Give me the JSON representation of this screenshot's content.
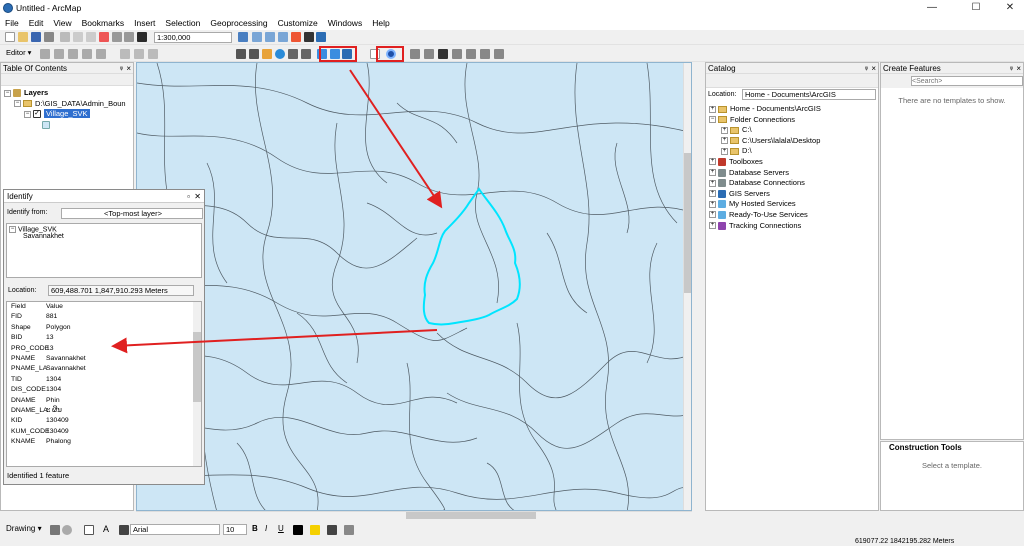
{
  "window": {
    "title": "Untitled - ArcMap",
    "min_icon": "minimize-icon",
    "max_icon": "maximize-icon",
    "close_icon": "close-icon",
    "min": "—",
    "max": "☐",
    "close": "✕"
  },
  "menu": [
    "File",
    "Edit",
    "View",
    "Bookmarks",
    "Insert",
    "Selection",
    "Geoprocessing",
    "Customize",
    "Windows",
    "Help"
  ],
  "toolbar": {
    "scale": "1:300,000",
    "editor": "Editor ▾"
  },
  "toc": {
    "title": "Table Of Contents",
    "root": "Layers",
    "group": "D:\\GIS_DATA\\Admin_Boun",
    "layer": "Village_SVK"
  },
  "identify": {
    "title": "Identify",
    "from_label": "Identify from:",
    "from_value": "<Top-most layer>",
    "tree_layer": "Village_SVK",
    "tree_feature": "Savannakhet",
    "location_label": "Location:",
    "location_value": "609,488.701  1,847,910.293 Meters",
    "header_field": "Field",
    "header_value": "Value",
    "rows": [
      [
        "FID",
        "881"
      ],
      [
        "Shape",
        "Polygon"
      ],
      [
        "BID",
        "13"
      ],
      [
        "PRO_CODE",
        "13"
      ],
      [
        "PNAME",
        "Savannakhet"
      ],
      [
        "PNAME_LA",
        "Savannakhet"
      ],
      [
        "TID",
        "1304"
      ],
      [
        "DIS_CODE",
        "1304"
      ],
      [
        "DNAME",
        "Phin"
      ],
      [
        "DNAME_LA",
        "ະ ຜີນ"
      ],
      [
        "KID",
        "130409"
      ],
      [
        "KUM_CODE",
        "130409"
      ],
      [
        "KNAME",
        "Phalong"
      ]
    ],
    "footer": "Identified 1 feature"
  },
  "catalog": {
    "title": "Catalog",
    "location_label": "Location:",
    "location_value": "Home - Documents\\ArcGIS",
    "items": [
      {
        "label": "Home - Documents\\ArcGIS",
        "level": 0,
        "icon": "folder-icon"
      },
      {
        "label": "Folder Connections",
        "level": 0,
        "icon": "folder-icon"
      },
      {
        "label": "C:\\",
        "level": 1,
        "icon": "folder-icon"
      },
      {
        "label": "C:\\Users\\lalala\\Desktop",
        "level": 1,
        "icon": "folder-icon"
      },
      {
        "label": "D:\\",
        "level": 1,
        "icon": "folder-icon"
      },
      {
        "label": "Toolboxes",
        "level": 0,
        "icon": "toolbox-icon"
      },
      {
        "label": "Database Servers",
        "level": 0,
        "icon": "database-icon"
      },
      {
        "label": "Database Connections",
        "level": 0,
        "icon": "database-icon"
      },
      {
        "label": "GIS Servers",
        "level": 0,
        "icon": "server-icon"
      },
      {
        "label": "My Hosted Services",
        "level": 0,
        "icon": "cloud-icon"
      },
      {
        "label": "Ready-To-Use Services",
        "level": 0,
        "icon": "cloud-icon"
      },
      {
        "label": "Tracking Connections",
        "level": 0,
        "icon": "tracking-icon"
      }
    ]
  },
  "create_features": {
    "title": "Create Features",
    "search_placeholder": "<Search>",
    "empty": "There are no templates to show."
  },
  "construction": {
    "title": "Construction Tools",
    "empty": "Select a template."
  },
  "drawing": {
    "label": "Drawing ▾",
    "font": "Arial",
    "size": "10",
    "bold": "B",
    "italic": "I",
    "underline": "U"
  },
  "status": {
    "coords": "619077.22  1842195.282 Meters"
  },
  "colors": {
    "map_bg": "#cde6f5",
    "highlight": "#00e5ff",
    "arrow": "#e02020",
    "box": "#e02020"
  }
}
